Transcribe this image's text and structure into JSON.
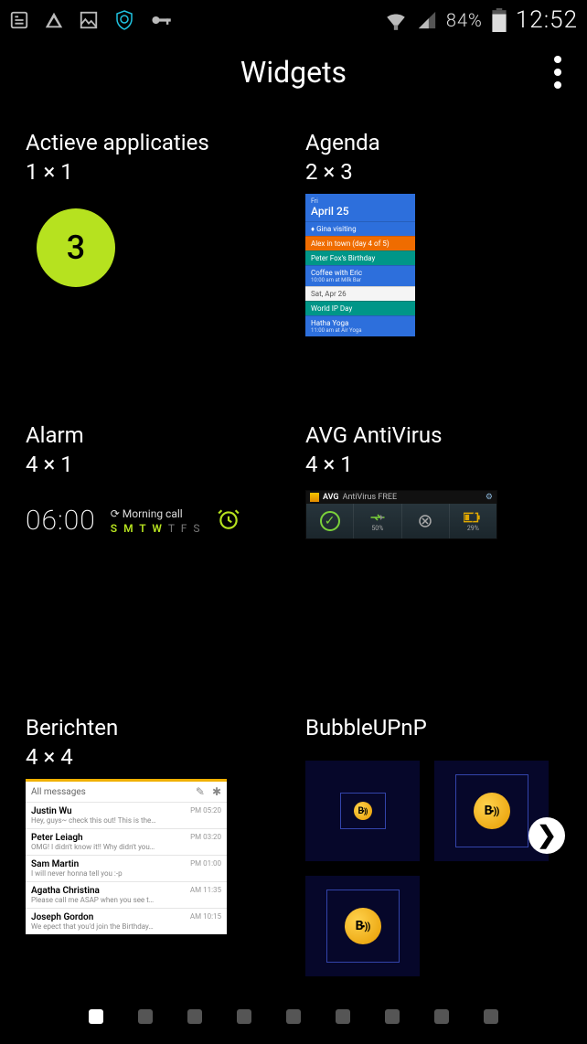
{
  "status": {
    "battery_pct": "84%",
    "clock": "12:52"
  },
  "header": {
    "title": "Widgets"
  },
  "widgets": [
    {
      "name": "Actieve applicaties",
      "size": "1 × 1",
      "active_apps": {
        "count": "3"
      }
    },
    {
      "name": "Agenda",
      "size": "2 × 3",
      "agenda": {
        "dow": "Fri",
        "date": "April 25",
        "rows": [
          {
            "cls": "ag-blue",
            "title": "♦ Gina visiting",
            "sub": ""
          },
          {
            "cls": "ag-orange",
            "title": "Alex in town (day 4 of 5)",
            "sub": ""
          },
          {
            "cls": "ag-teal",
            "title": "Peter Fox's Birthday",
            "sub": ""
          },
          {
            "cls": "ag-blue",
            "title": "Coffee with Eric",
            "sub": "10:00 am at Milk Bar"
          },
          {
            "cls": "ag-white",
            "title": "Sat, Apr 26",
            "sub": ""
          },
          {
            "cls": "ag-teal",
            "title": "World IP Day",
            "sub": ""
          },
          {
            "cls": "ag-blue",
            "title": "Hatha Yoga",
            "sub": "11:00 am at Air Yoga"
          }
        ]
      }
    },
    {
      "name": "Alarm",
      "size": "4 × 1",
      "alarm": {
        "time": "06:00",
        "label": "Morning call",
        "days": [
          "S",
          "M",
          "T",
          "W",
          "T",
          "F",
          "S"
        ],
        "daysOn": [
          true,
          true,
          true,
          true,
          false,
          false,
          false
        ]
      }
    },
    {
      "name": "AVG AntiVirus",
      "size": "4 × 1",
      "avg": {
        "titleBrand": "AVG",
        "titleRest": "AntiVirus FREE",
        "scanPct": "50%",
        "battPct": "29%"
      }
    },
    {
      "name": "Berichten",
      "size": "4 × 4",
      "messages": {
        "header": "All messages",
        "rows": [
          {
            "from": "Justin Wu",
            "text": "Hey, guys~ check this out! This is the…",
            "time": "PM 05:20"
          },
          {
            "from": "Peter Leiagh",
            "text": "OMG! I didn't know it!! Why didn't you…",
            "time": "PM 03:20"
          },
          {
            "from": "Sam Martin",
            "text": "I will never honna tell you :-p",
            "time": "PM 01:00"
          },
          {
            "from": "Agatha Christina",
            "text": "Please call me ASAP when you see t…",
            "time": "AM 11:35"
          },
          {
            "from": "Joseph Gordon",
            "text": "We epect that you'd join the Birthday…",
            "time": "AM 10:15"
          }
        ]
      }
    },
    {
      "name": "BubbleUPnP",
      "size": ""
    }
  ],
  "pager": {
    "count": 9,
    "active": 0
  }
}
